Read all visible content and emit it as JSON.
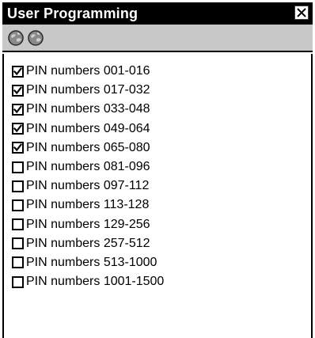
{
  "window": {
    "title": "User Programming",
    "close_icon": "close-x-icon"
  },
  "toolbar": {
    "buttons": [
      {
        "icon": "globe-icon",
        "color": "#808080"
      },
      {
        "icon": "globe-icon",
        "color": "#808080"
      }
    ]
  },
  "list": {
    "items": [
      {
        "label": "PIN numbers 001-016",
        "checked": true
      },
      {
        "label": "PIN numbers 017-032",
        "checked": true
      },
      {
        "label": "PIN numbers 033-048",
        "checked": true
      },
      {
        "label": "PIN numbers 049-064",
        "checked": true
      },
      {
        "label": "PIN numbers 065-080",
        "checked": true
      },
      {
        "label": "PIN numbers 081-096",
        "checked": false
      },
      {
        "label": "PIN numbers 097-112",
        "checked": false
      },
      {
        "label": "PIN numbers 113-128",
        "checked": false
      },
      {
        "label": "PIN numbers 129-256",
        "checked": false
      },
      {
        "label": "PIN numbers 257-512",
        "checked": false
      },
      {
        "label": "PIN numbers 513-1000",
        "checked": false
      },
      {
        "label": "PIN numbers 1001-1500",
        "checked": false
      }
    ]
  },
  "colors": {
    "titlebar_bg": "#000000",
    "titlebar_text": "#ffffff",
    "toolbar_bg": "#c8c8c8",
    "list_bg": "#ffffff"
  }
}
